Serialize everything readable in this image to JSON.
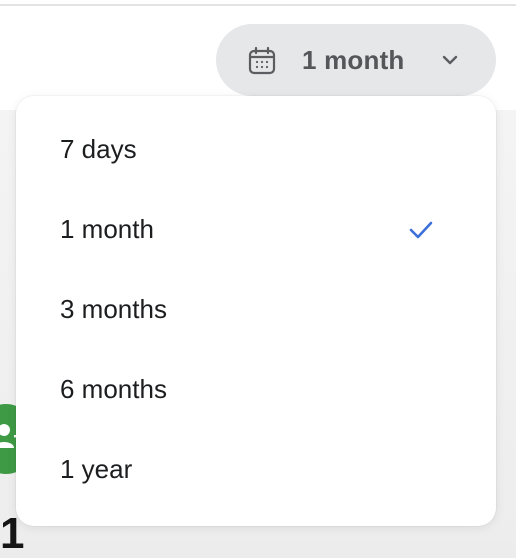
{
  "period_selector": {
    "icon": "calendar-icon",
    "selected_label": "1 month",
    "chevron_icon": "chevron-down-icon"
  },
  "menu": {
    "items": [
      {
        "label": "7 days",
        "selected": false
      },
      {
        "label": "1 month",
        "selected": true
      },
      {
        "label": "3 months",
        "selected": false
      },
      {
        "label": "6 months",
        "selected": false
      },
      {
        "label": "1 year",
        "selected": false
      }
    ],
    "check_icon": "checkmark-icon"
  },
  "background": {
    "partial_number": "1",
    "avatar_icon": "add-person-icon"
  },
  "colors": {
    "accent": "#3c6fd9",
    "button_bg": "#e6e7e9",
    "avatar_green": "#3e9a45"
  }
}
